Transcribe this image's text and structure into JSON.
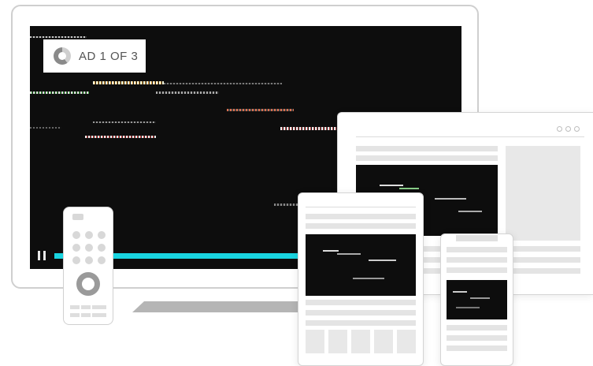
{
  "ad": {
    "label": "AD 1 OF 3",
    "progress": 0.6
  },
  "player": {
    "state": "paused",
    "progress_color": "#19d4e0",
    "pause_icon": "pause-icon"
  },
  "devices": [
    "tv",
    "remote",
    "laptop",
    "tablet",
    "phone"
  ],
  "colors": {
    "video_bg": "#0d0d0d",
    "frame": "#cfcfcf",
    "placeholder": "#e4e4e4"
  }
}
